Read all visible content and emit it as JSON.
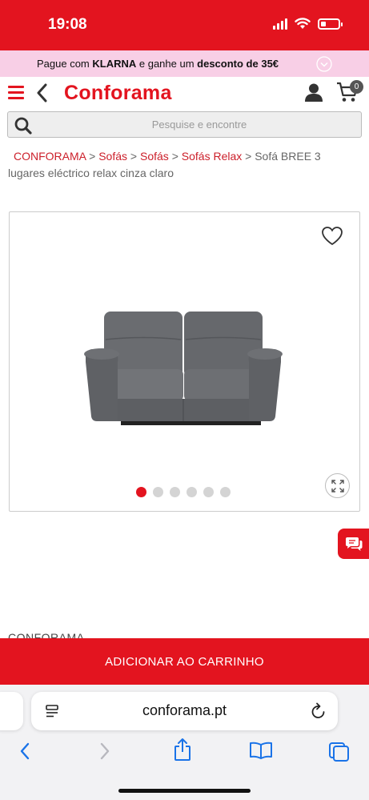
{
  "status_bar": {
    "time": "19:08",
    "battery_level": 0.3,
    "background_color": "#e3141f"
  },
  "promo": {
    "text_before": "Pague com ",
    "klarna": "KLARNA",
    "text_middle": " e ganhe um ",
    "discount": "desconto de 35€",
    "background_color": "#f8cfe6"
  },
  "header": {
    "logo": "Conforama",
    "cart_count": "0",
    "brand_color": "#e3141f"
  },
  "search": {
    "placeholder": "Pesquise e encontre"
  },
  "breadcrumb": {
    "items": [
      "CONFORAMA",
      "Sofás",
      "Sofás",
      "Sofás Relax"
    ],
    "separator": ">",
    "current": "Sofá BREE 3 lugares eléctrico relax cinza claro"
  },
  "gallery": {
    "image_count": 6,
    "active_index": 0,
    "product_image": "sofa-grey-recliner"
  },
  "brand_label": "CONFORAMA",
  "add_to_cart": {
    "label": "ADICIONAR AO CARRINHO"
  },
  "browser": {
    "url": "conforama.pt",
    "icons": [
      "tab-menu-icon",
      "reload-icon",
      "back-icon",
      "forward-icon",
      "share-icon",
      "bookmarks-icon",
      "tabs-icon"
    ]
  }
}
